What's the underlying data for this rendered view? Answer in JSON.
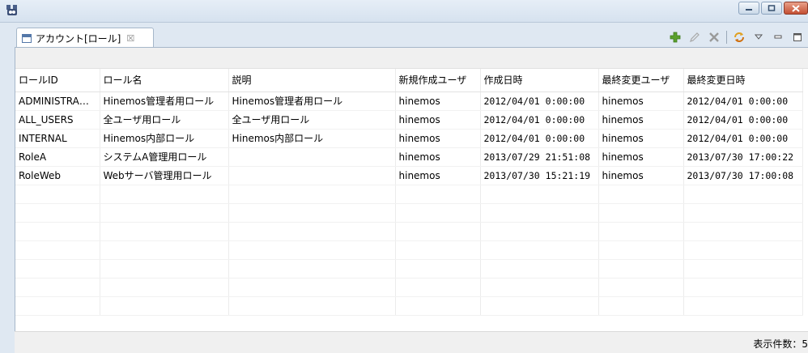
{
  "window": {
    "minimize_icon": "minimize-icon",
    "maximize_icon": "maximize-icon",
    "close_icon": "close-icon"
  },
  "view": {
    "tab_label": "アカウント[ロール]",
    "tab_close": "☒"
  },
  "toolbar": {
    "items": [
      "add-icon",
      "edit-icon",
      "delete-icon",
      "refresh-icon",
      "view-menu-icon",
      "minimize-icon",
      "maximize-icon"
    ]
  },
  "table": {
    "columns": [
      "ロールID",
      "ロール名",
      "説明",
      "新規作成ユーザ",
      "作成日時",
      "最終変更ユーザ",
      "最終変更日時"
    ],
    "rows": [
      [
        "ADMINISTRA…",
        "Hinemos管理者用ロール",
        "Hinemos管理者用ロール",
        "hinemos",
        "2012/04/01 0:00:00",
        "hinemos",
        "2012/04/01 0:00:00"
      ],
      [
        "ALL_USERS",
        "全ユーザ用ロール",
        "全ユーザ用ロール",
        "hinemos",
        "2012/04/01 0:00:00",
        "hinemos",
        "2012/04/01 0:00:00"
      ],
      [
        "INTERNAL",
        "Hinemos内部ロール",
        "Hinemos内部ロール",
        "hinemos",
        "2012/04/01 0:00:00",
        "hinemos",
        "2012/04/01 0:00:00"
      ],
      [
        "RoleA",
        "システムA管理用ロール",
        "",
        "hinemos",
        "2013/07/29 21:51:08",
        "hinemos",
        "2013/07/30 17:00:22"
      ],
      [
        "RoleWeb",
        "Webサーバ管理用ロール",
        "",
        "hinemos",
        "2013/07/30 15:21:19",
        "hinemos",
        "2013/07/30 17:00:08"
      ]
    ]
  },
  "status": {
    "count_label": "表示件数：5"
  }
}
